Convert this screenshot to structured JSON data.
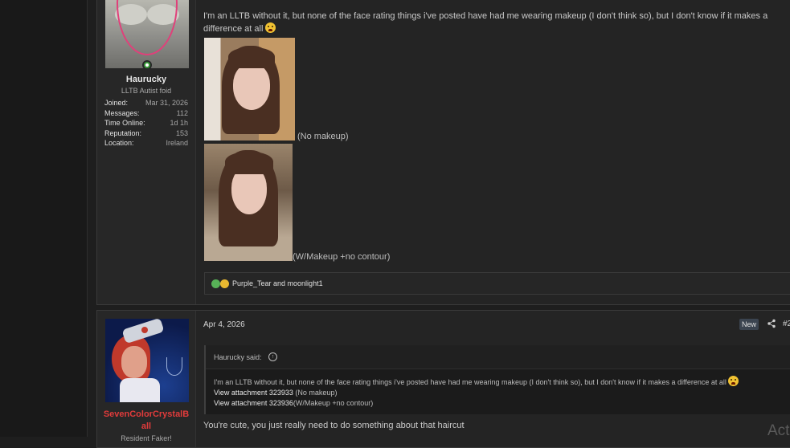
{
  "post1": {
    "username": "Haurucky",
    "user_title": "LLTB Autist foid",
    "stats": [
      {
        "label": "Joined:",
        "value": "Mar 31, 2026"
      },
      {
        "label": "Messages:",
        "value": "112"
      },
      {
        "label": "Time Online:",
        "value": "1d 1h"
      },
      {
        "label": "Reputation:",
        "value": "153"
      },
      {
        "label": "Location:",
        "value": "Ireland"
      }
    ],
    "message": "I'm an LLTB without it, but none of the face rating things i've posted have had me wearing makeup (I don't think so), but I don't know if it makes a difference at all",
    "captions": [
      "(No makeup)",
      "(W/Makeup +no contour)"
    ],
    "reactions": "Purple_Tear and moonlight1"
  },
  "post2": {
    "username": "SevenColorCrystalBall",
    "user_title": "Resident Faker!",
    "date": "Apr 4, 2026",
    "badge": "New",
    "post_number": "#2",
    "quote_author": "Haurucky said:",
    "quote_text": "I'm an LLTB without it, but none of the face rating things i've posted have had me wearing makeup (I don't think so), but I don't know if it makes a difference at all",
    "attachment1": "View attachment 323933",
    "attachment1_note": "(No makeup)",
    "attachment2": "View attachment 323936",
    "attachment2_note": "(W/Makeup +no contour)",
    "message": "You're cute, you just really need to do something about that haircut"
  },
  "overlay": {
    "text": "Act"
  }
}
